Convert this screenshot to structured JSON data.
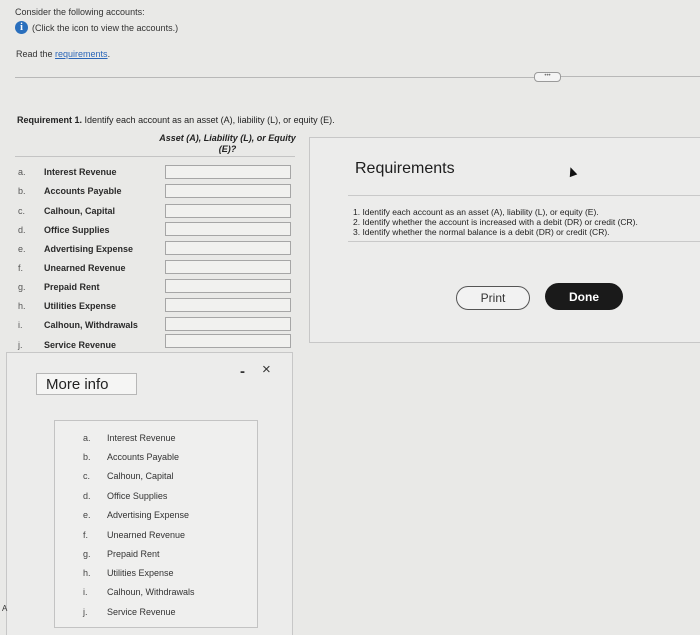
{
  "intro": {
    "line1": "Consider the following accounts:",
    "info_text": "(Click the icon to view the accounts.)",
    "read_prefix": "Read the ",
    "read_link": "requirements",
    "read_suffix": "."
  },
  "requirement1": {
    "label": "Requirement 1.",
    "text": " Identify each account as an asset (A), liability (L), or equity (E).",
    "column_header": "Asset (A), Liability (L), or Equity (E)?"
  },
  "accounts": [
    {
      "letter": "a.",
      "name": "Interest Revenue",
      "value": ""
    },
    {
      "letter": "b.",
      "name": "Accounts Payable",
      "value": ""
    },
    {
      "letter": "c.",
      "name": "Calhoun, Capital",
      "value": ""
    },
    {
      "letter": "d.",
      "name": "Office Supplies",
      "value": ""
    },
    {
      "letter": "e.",
      "name": "Advertising Expense",
      "value": ""
    },
    {
      "letter": "f.",
      "name": "Unearned Revenue",
      "value": ""
    },
    {
      "letter": "g.",
      "name": "Prepaid Rent",
      "value": ""
    },
    {
      "letter": "h.",
      "name": "Utilities Expense",
      "value": ""
    },
    {
      "letter": "i.",
      "name": "Calhoun, Withdrawals",
      "value": ""
    },
    {
      "letter": "j.",
      "name": "Service Revenue",
      "value": ""
    }
  ],
  "requirements_panel": {
    "title": "Requirements",
    "items": [
      "1. Identify each account as an asset (A), liability (L), or equity (E).",
      "2. Identify whether the account is increased with a debit (DR) or credit (CR).",
      "3. Identify whether the normal balance is a debit (DR) or credit (CR)."
    ],
    "print_label": "Print",
    "done_label": "Done"
  },
  "more_info": {
    "title": "More info",
    "minimize_glyph": "-",
    "close_glyph": "×",
    "items": [
      {
        "letter": "a.",
        "name": "Interest Revenue"
      },
      {
        "letter": "b.",
        "name": "Accounts Payable"
      },
      {
        "letter": "c.",
        "name": "Calhoun, Capital"
      },
      {
        "letter": "d.",
        "name": "Office Supplies"
      },
      {
        "letter": "e.",
        "name": "Advertising Expense"
      },
      {
        "letter": "f.",
        "name": "Unearned Revenue"
      },
      {
        "letter": "g.",
        "name": "Prepaid Rent"
      },
      {
        "letter": "h.",
        "name": "Utilities Expense"
      },
      {
        "letter": "i.",
        "name": "Calhoun, Withdrawals"
      },
      {
        "letter": "j.",
        "name": "Service Revenue"
      }
    ]
  },
  "side_mark": "A",
  "colors": {
    "accent": "#2a6fbd",
    "link": "#2a66b8",
    "done_bg": "#1a1a1a"
  }
}
